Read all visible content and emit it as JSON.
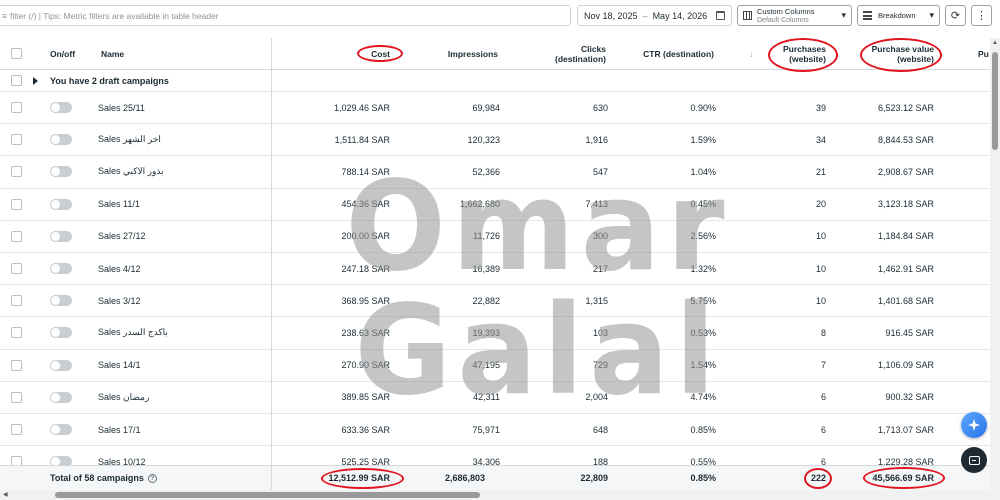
{
  "toolbar": {
    "filter_placeholder": "filter (/) | Tips: Metric filters are available in table header",
    "date_start": "Nov 18, 2025",
    "date_sep": "–",
    "date_end": "May 14, 2026",
    "columns_label": "Custom Columns",
    "columns_sub": "Default Columns",
    "breakdown_label": "Breakdown",
    "refresh_icon": "refresh-icon",
    "more_icon": "more-vertical-icon"
  },
  "table": {
    "headers": {
      "onoff": "On/off",
      "name": "Name",
      "cost": "Cost",
      "impressions": "Impressions",
      "clicks_1": "Clicks",
      "clicks_2": "(destination)",
      "ctr": "CTR (destination)",
      "sort_icon": "↓",
      "purchases_1": "Purchases",
      "purchases_2": "(website)",
      "pv_1": "Purchase value",
      "pv_2": "(website)",
      "next": "Pu"
    },
    "draft_label": "You have 2 draft campaigns",
    "rows": [
      {
        "name": "Sales 25/11",
        "cost": "1,029.46 SAR",
        "impressions": "69,984",
        "clicks": "630",
        "ctr": "0.90%",
        "purchases": "39",
        "value": "6,523.12 SAR"
      },
      {
        "name": "Sales اخر الشهر",
        "cost": "1,511.84 SAR",
        "impressions": "120,323",
        "clicks": "1,916",
        "ctr": "1.59%",
        "purchases": "34",
        "value": "8,844.53 SAR"
      },
      {
        "name": "Sales بذور الاكبي",
        "cost": "788.14 SAR",
        "impressions": "52,366",
        "clicks": "547",
        "ctr": "1.04%",
        "purchases": "21",
        "value": "2,908.67 SAR"
      },
      {
        "name": "Sales 11/1",
        "cost": "454.36 SAR",
        "impressions": "1,662,680",
        "clicks": "7,413",
        "ctr": "0.45%",
        "purchases": "20",
        "value": "3,123.18 SAR"
      },
      {
        "name": "Sales 27/12",
        "cost": "200.00 SAR",
        "impressions": "11,726",
        "clicks": "300",
        "ctr": "2.56%",
        "purchases": "10",
        "value": "1,184.84 SAR"
      },
      {
        "name": "Sales 4/12",
        "cost": "247.18 SAR",
        "impressions": "16,389",
        "clicks": "217",
        "ctr": "1.32%",
        "purchases": "10",
        "value": "1,462.91 SAR"
      },
      {
        "name": "Sales 3/12",
        "cost": "368.95 SAR",
        "impressions": "22,882",
        "clicks": "1,315",
        "ctr": "5.75%",
        "purchases": "10",
        "value": "1,401.68 SAR"
      },
      {
        "name": "Sales باكدج السدر",
        "cost": "238.63 SAR",
        "impressions": "19,393",
        "clicks": "103",
        "ctr": "0.53%",
        "purchases": "8",
        "value": "916.45 SAR"
      },
      {
        "name": "Sales 14/1",
        "cost": "270.90 SAR",
        "impressions": "47,195",
        "clicks": "729",
        "ctr": "1.54%",
        "purchases": "7",
        "value": "1,106.09 SAR"
      },
      {
        "name": "Sales رمضان",
        "cost": "389.85 SAR",
        "impressions": "42,311",
        "clicks": "2,004",
        "ctr": "4.74%",
        "purchases": "6",
        "value": "900.32 SAR"
      },
      {
        "name": "Sales 17/1",
        "cost": "633.36 SAR",
        "impressions": "75,971",
        "clicks": "648",
        "ctr": "0.85%",
        "purchases": "6",
        "value": "1,713.07 SAR"
      },
      {
        "name": "Sales 10/12",
        "cost": "525.25 SAR",
        "impressions": "34,306",
        "clicks": "188",
        "ctr": "0.55%",
        "purchases": "6",
        "value": "1,229.28 SAR"
      }
    ],
    "total": {
      "label": "Total of 58 campaigns",
      "cost": "12,512.99 SAR",
      "impressions": "2,686,803",
      "clicks": "22,809",
      "ctr": "0.85%",
      "purchases": "222",
      "value": "45,566.69 SAR"
    }
  },
  "watermark": "Omar Galal",
  "annotation_color": "#e0141e",
  "fab": {
    "ai_icon": "sparkle-icon",
    "chat_icon": "chat-icon"
  }
}
